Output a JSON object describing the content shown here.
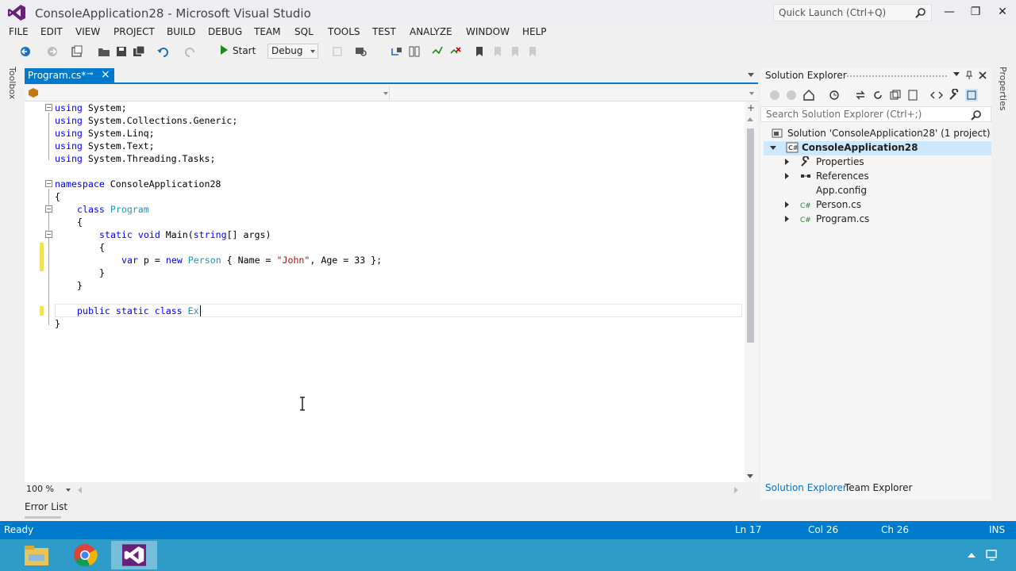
{
  "window": {
    "title": "ConsoleApplication28 - Microsoft Visual Studio",
    "quick_launch_placeholder": "Quick Launch (Ctrl+Q)",
    "minimize": "—",
    "restore": "❐",
    "close": "✕"
  },
  "menu": [
    "FILE",
    "EDIT",
    "VIEW",
    "PROJECT",
    "BUILD",
    "DEBUG",
    "TEAM",
    "SQL",
    "TOOLS",
    "TEST",
    "ANALYZE",
    "WINDOW",
    "HELP"
  ],
  "toolbar": {
    "start_label": "Start",
    "config_value": "Debug"
  },
  "side_tabs": {
    "toolbox": "Toolbox",
    "properties": "Properties"
  },
  "editor": {
    "tab_label": "Program.cs*",
    "pin_glyph": "⊸",
    "close_glyph": "×",
    "zoom": "100 %",
    "split_glyph": "+",
    "code": {
      "l1_kw": "using",
      "l1_rest": " System;",
      "l2_kw": "using",
      "l2_rest": " System.Collections.Generic;",
      "l3_kw": "using",
      "l3_rest": " System.Linq;",
      "l4_kw": "using",
      "l4_rest": " System.Text;",
      "l5_kw": "using",
      "l5_rest": " System.Threading.Tasks;",
      "l7_kw": "namespace",
      "l7_rest": " ConsoleApplication28",
      "l8": "{",
      "l9_kw": "class",
      "l9_ty": "Program",
      "l10": "{",
      "l11_kw1": "static",
      "l11_kw2": "void",
      "l11_rest1": " Main(",
      "l11_kw3": "string",
      "l11_rest2": "[] args)",
      "l12": "{",
      "l13_kw1": "var",
      "l13_rest1": " p = ",
      "l13_kw2": "new",
      "l13_ty": "Person",
      "l13_rest2": " { Name = ",
      "l13_str": "\"John\"",
      "l13_rest3": ", Age = 33 };",
      "l14": "}",
      "l15": "}",
      "l17_kw1": "public",
      "l17_kw2": "static",
      "l17_kw3": "class",
      "l17_ty": "Ex",
      "l18": "}"
    }
  },
  "error_list": "Error List",
  "solution_explorer": {
    "title": "Solution Explorer",
    "search_placeholder": "Search Solution Explorer (Ctrl+;)",
    "solution": "Solution 'ConsoleApplication28' (1 project)",
    "project": "ConsoleApplication28",
    "items": [
      "Properties",
      "References",
      "App.config",
      "Person.cs",
      "Program.cs"
    ],
    "tab_solution": "Solution Explorer",
    "tab_team": "Team Explorer"
  },
  "status": {
    "ready": "Ready",
    "ln": "Ln 17",
    "col": "Col 26",
    "ch": "Ch 26",
    "mode": "INS"
  },
  "colors": {
    "accent": "#007acc",
    "keyword": "#0000ff",
    "type": "#2b91af",
    "string": "#a31515"
  }
}
